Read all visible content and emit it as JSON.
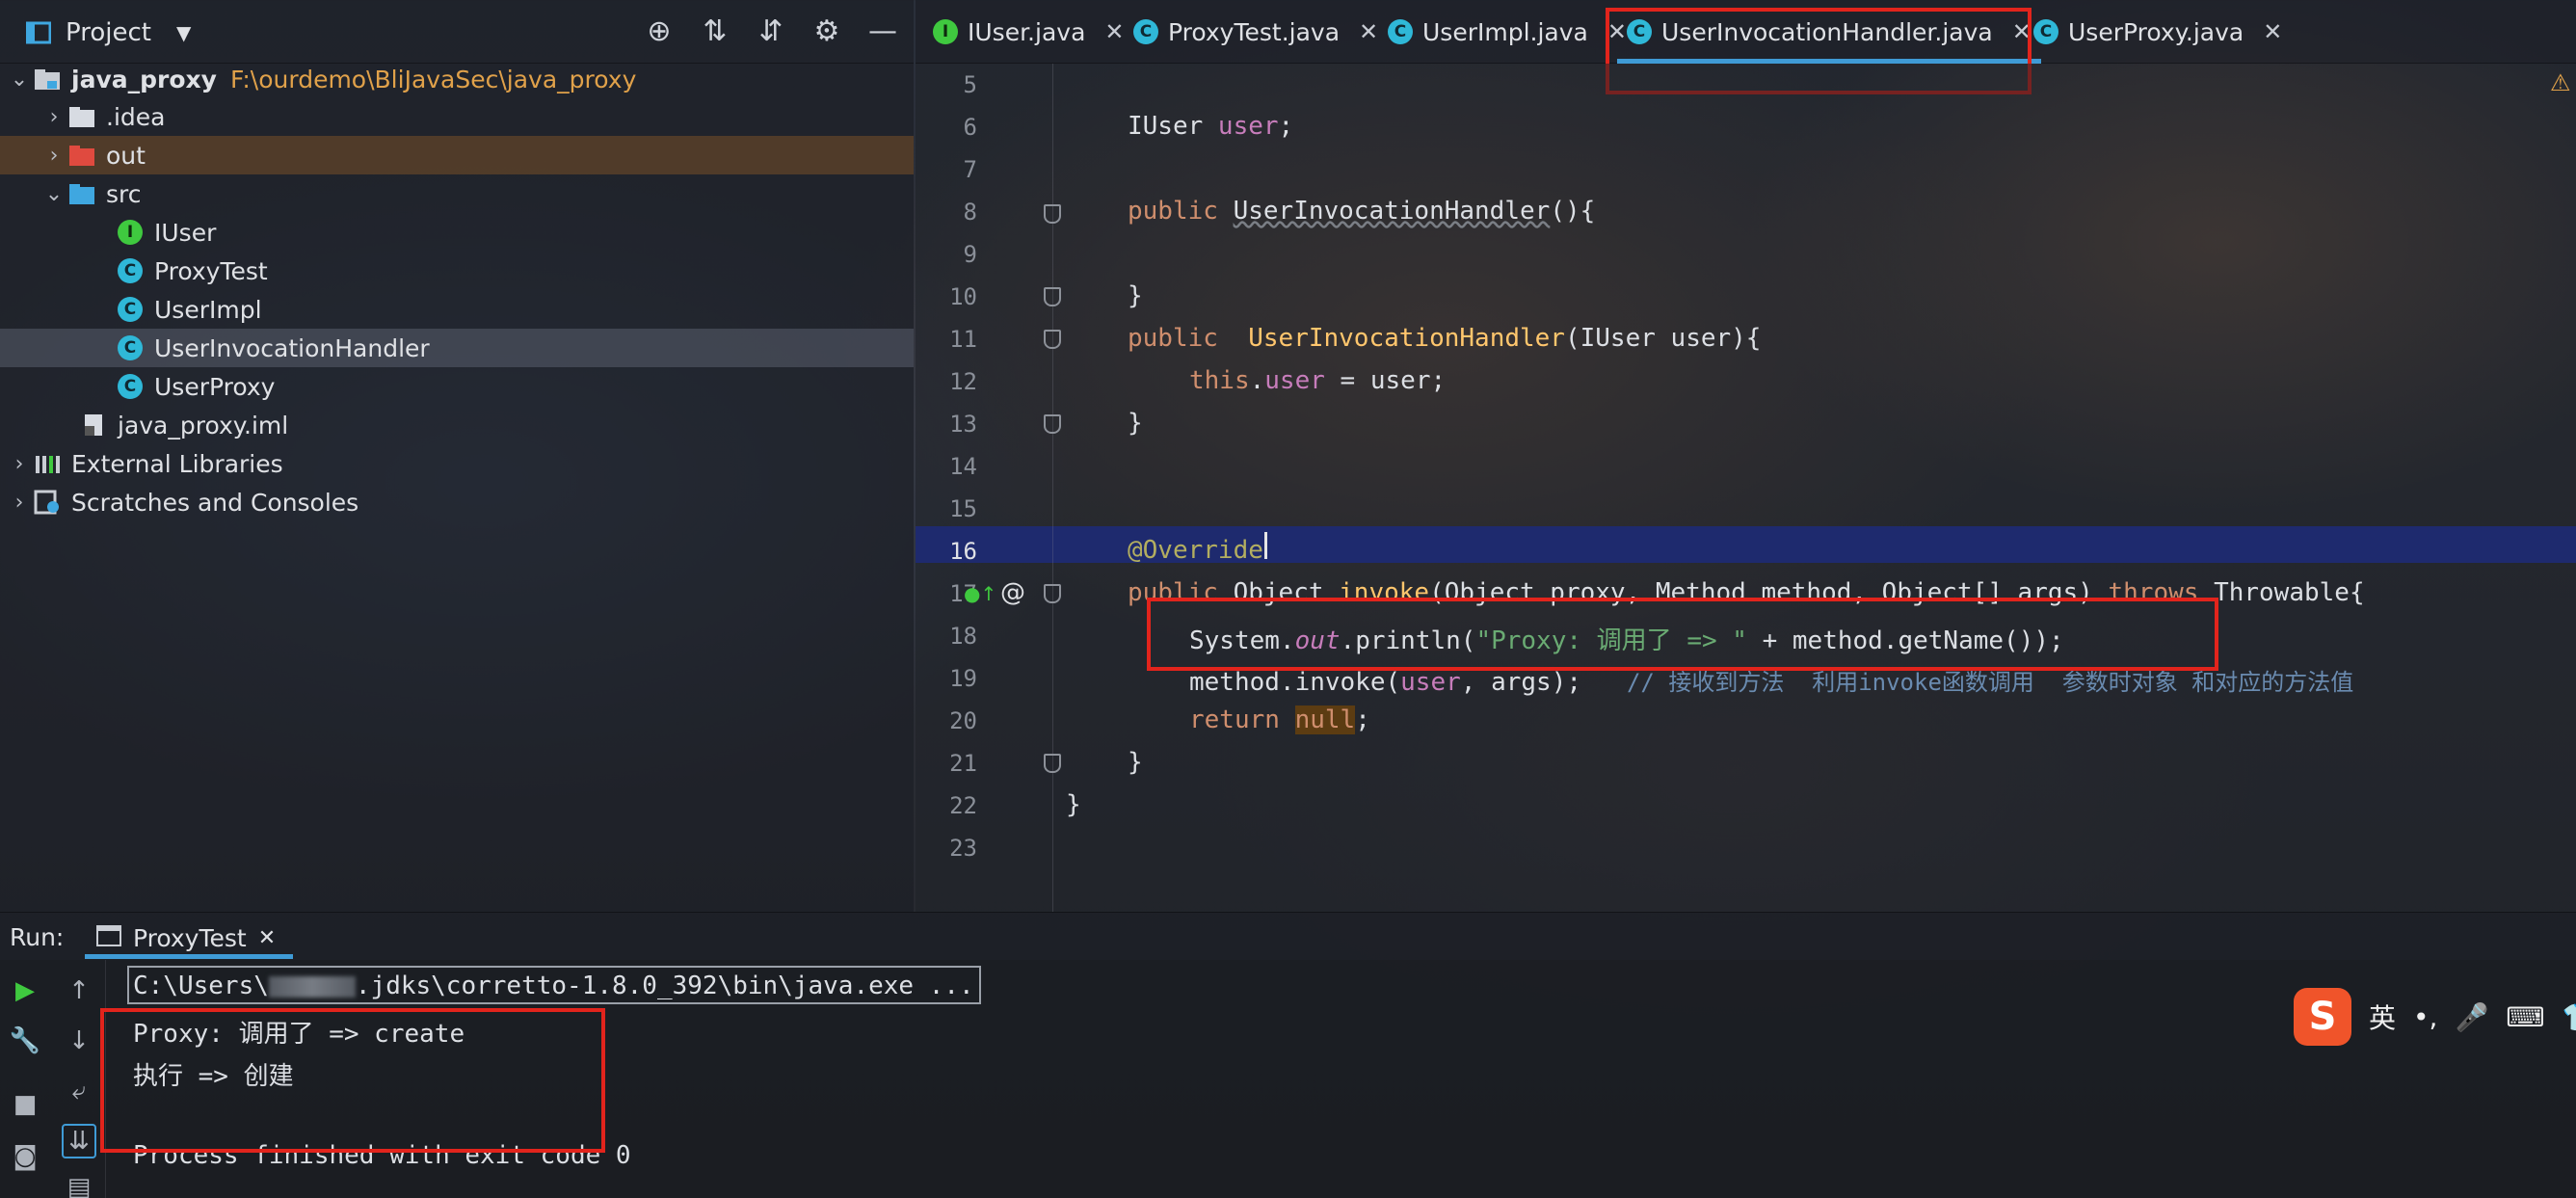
{
  "project_panel": {
    "title": "Project",
    "tree": [
      {
        "label": "java_proxy",
        "path": "F:\\ourdemo\\BliJavaSec\\java_proxy",
        "icon": "module-folder-icon"
      },
      {
        "label": ".idea",
        "icon": "folder-icon"
      },
      {
        "label": "out",
        "icon": "excluded-folder-icon"
      },
      {
        "label": "src",
        "icon": "source-folder-icon"
      },
      {
        "label": "IUser",
        "icon": "interface-icon"
      },
      {
        "label": "ProxyTest",
        "icon": "class-icon"
      },
      {
        "label": "UserImpl",
        "icon": "class-icon"
      },
      {
        "label": "UserInvocationHandler",
        "icon": "class-icon"
      },
      {
        "label": "UserProxy",
        "icon": "class-icon"
      },
      {
        "label": "java_proxy.iml",
        "icon": "iml-file-icon"
      },
      {
        "label": "External Libraries",
        "icon": "library-icon"
      },
      {
        "label": "Scratches and Consoles",
        "icon": "scratch-icon"
      }
    ]
  },
  "editor": {
    "tabs": [
      {
        "label": "IUser.java",
        "icon_letter": "I"
      },
      {
        "label": "ProxyTest.java",
        "icon_letter": "C"
      },
      {
        "label": "UserImpl.java",
        "icon_letter": "C"
      },
      {
        "label": "UserInvocationHandler.java",
        "icon_letter": "C",
        "active": true
      },
      {
        "label": "UserProxy.java",
        "icon_letter": "C"
      }
    ],
    "line_numbers": [
      "5",
      "6",
      "7",
      "8",
      "9",
      "10",
      "11",
      "12",
      "13",
      "14",
      "15",
      "16",
      "17",
      "18",
      "19",
      "20",
      "21",
      "22",
      "23"
    ],
    "code": {
      "l6_type": "IUser ",
      "l6_field": "user",
      "l6_end": ";",
      "l8_kw": "public ",
      "l8_name": "UserInvocationHandler",
      "l8_end": "(){",
      "l10": "}",
      "l11_kw": "public  ",
      "l11_name": "UserInvocationHandler",
      "l11_end": "(IUser user){",
      "l12_kw": "this",
      "l12_dot": ".",
      "l12_field": "user",
      "l12_end": " = user;",
      "l13": "}",
      "l16": "@Override",
      "l17_kw": "public ",
      "l17_a": "Object ",
      "l17_name": "invoke",
      "l17_b": "(Object proxy, Method method, Object[] args) ",
      "l17_throws": "throws ",
      "l17_c": "Throwable{",
      "l18_a": "System.",
      "l18_out": "out",
      "l18_b": ".println(",
      "l18_str": "\"Proxy: 调用了 => \"",
      "l18_c": " + method.getName());",
      "l19_a": "method.invoke(",
      "l19_field": "user",
      "l19_b": ", args);   ",
      "l19_cmt": "// 接收到方法  利用invoke函数调用  参数时对象 和对应的方法值",
      "l20_kw": "return ",
      "l20_null": "null",
      "l20_end": ";",
      "l21": "}",
      "l22": "}"
    }
  },
  "run_panel": {
    "label": "Run:",
    "tab": "ProxyTest",
    "console": {
      "cmd_prefix": "C:\\Users\\",
      "cmd_suffix": ".jdks\\corretto-1.8.0_392\\bin\\java.exe ...",
      "line1": "Proxy: 调用了 => create",
      "line2": "执行 => 创建",
      "line3": "Process finished with exit code 0"
    }
  },
  "ime": {
    "logo": "S",
    "lang": "英",
    "punct": "•,"
  },
  "colors": {
    "accent_blue": "#3f9bd6",
    "annotation_red": "#e2241c",
    "class_icon": "#2fb8d8",
    "interface_icon": "#3fc93f",
    "keyword": "#cf8e6d",
    "string": "#6aab73",
    "field": "#c77dbb"
  }
}
